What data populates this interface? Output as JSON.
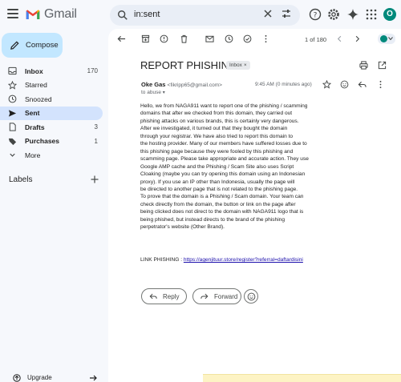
{
  "app": {
    "name": "Gmail"
  },
  "search": {
    "value": "in:sent"
  },
  "sidebar": {
    "compose_label": "Compose",
    "items": [
      {
        "label": "Inbox",
        "count": "170",
        "icon": "inbox-icon"
      },
      {
        "label": "Starred",
        "count": "",
        "icon": "star-icon"
      },
      {
        "label": "Snoozed",
        "count": "",
        "icon": "clock-icon"
      },
      {
        "label": "Sent",
        "count": "",
        "icon": "send-icon"
      },
      {
        "label": "Drafts",
        "count": "3",
        "icon": "draft-icon"
      },
      {
        "label": "Purchases",
        "count": "1",
        "icon": "tag-icon"
      },
      {
        "label": "More",
        "count": "",
        "icon": "chevron-down-icon"
      }
    ],
    "labels_heading": "Labels",
    "upgrade_label": "Upgrade"
  },
  "toolbar": {
    "pager": "1 of 180"
  },
  "email": {
    "subject": "REPORT PHISHING",
    "label_badge": "Inbox",
    "avatar_letter": "O",
    "sender_name": "Oke Gas",
    "sender_email": "<fikripp65@gmail.com>",
    "to_line": "to abuse",
    "time": "9:45 AM (0 minutes ago)",
    "body_lines": [
      "Hello, we from NAGA911 want to report one of the phishing / scamming",
      "domains that after we checked from this domain, they carried out",
      "phishing attacks on various brands, this is certainly very dangerous.",
      "After we investigated, it turned out that they bought the domain",
      "through your registrar. We have also tried to report this domain to",
      "the hosting provider. Many of our members have suffered losses due to",
      "this phishing page because they were fooled by this phishing and",
      "scamming page. Please take appropriate and accurate action. They use",
      "Google AMP cache and the Phishing / Scam Site also uses Script",
      "Cloaking (maybe you can try opening this domain using an Indonesian",
      "proxy). If you use an IP other than Indonesia, usually the page will",
      "be directed to another page that is not related to the phishing page.",
      "To prove that the domain is a Phishing / Scam domain. Your team can",
      "check directly from the domain, the button or link on the page after",
      "being clicked does not direct to the domain with NAGA911 logo that is",
      "being phished, but instead directs to the brand of the phishing",
      "perpetrator's website (Other Brand)."
    ],
    "link_prefix": "LINK PHISHING : ",
    "link_url": "https://agenjituur.store/register?referral=daftardisini",
    "reply_label": "Reply",
    "forward_label": "Forward"
  },
  "user": {
    "avatar_letter": "O"
  },
  "colors": {
    "accent": "#0b57d0",
    "compose_bg": "#c2e7ff",
    "active_nav": "#d3e3fd",
    "avatar": "#00897b"
  }
}
